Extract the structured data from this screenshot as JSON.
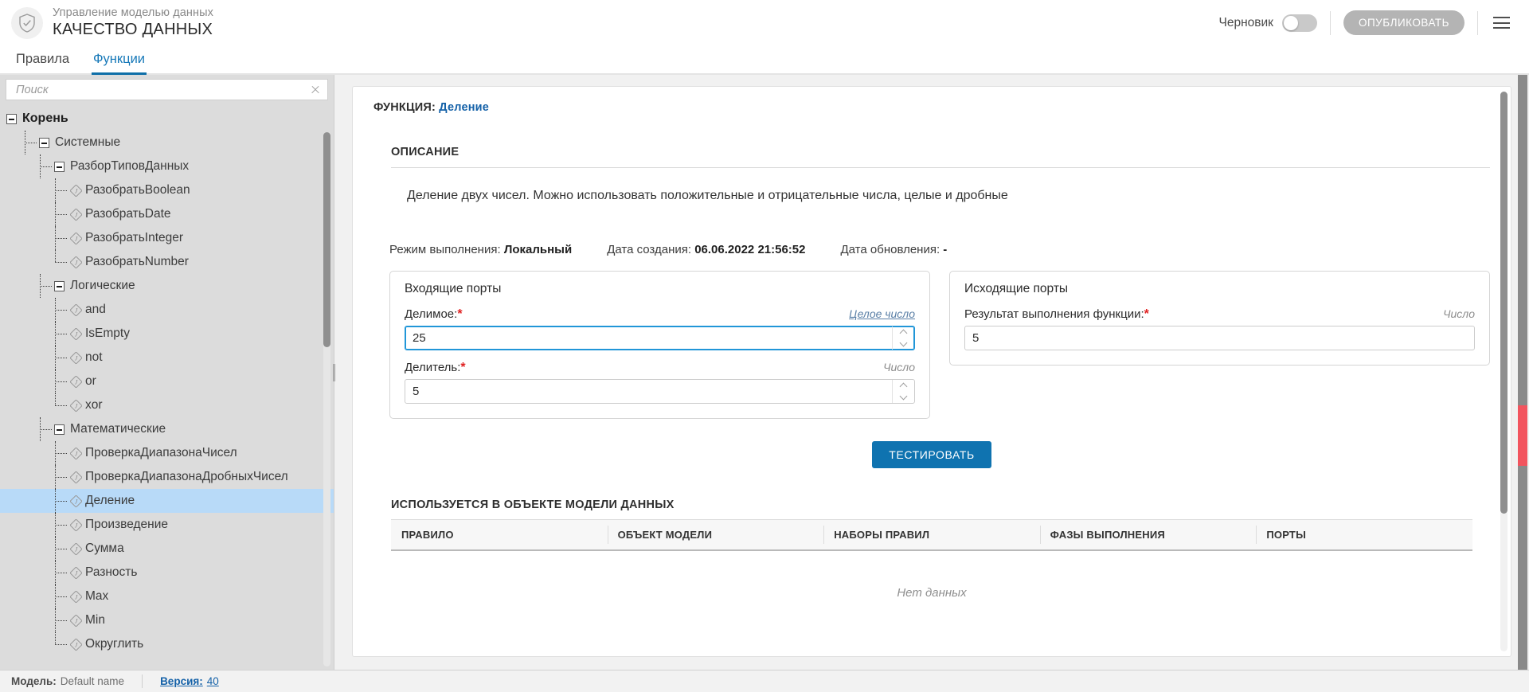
{
  "header": {
    "subtitle": "Управление моделью данных",
    "title": "КАЧЕСТВО ДАННЫХ",
    "shield_icon": "shield-check-icon",
    "draft_label": "Черновик",
    "draft_toggle_on": false,
    "publish_label": "ОПУБЛИКОВАТЬ",
    "menu_icon": "hamburger-menu-icon"
  },
  "tabs": [
    {
      "label": "Правила",
      "active": false
    },
    {
      "label": "Функции",
      "active": true
    }
  ],
  "sidebar": {
    "search_placeholder": "Поиск",
    "search_value": "",
    "clear_icon": "close-icon",
    "tree": [
      {
        "label": "Корень",
        "depth": 0,
        "type": "folder",
        "expanded": true,
        "selected": false,
        "last": false
      },
      {
        "label": "Системные",
        "depth": 1,
        "type": "folder",
        "expanded": true,
        "selected": false,
        "last": false
      },
      {
        "label": "РазборТиповДанных",
        "depth": 2,
        "type": "folder",
        "expanded": true,
        "selected": false,
        "last": false
      },
      {
        "label": "РазобратьBoolean",
        "depth": 3,
        "type": "function",
        "expanded": false,
        "selected": false,
        "last": false
      },
      {
        "label": "РазобратьDate",
        "depth": 3,
        "type": "function",
        "expanded": false,
        "selected": false,
        "last": false
      },
      {
        "label": "РазобратьInteger",
        "depth": 3,
        "type": "function",
        "expanded": false,
        "selected": false,
        "last": false
      },
      {
        "label": "РазобратьNumber",
        "depth": 3,
        "type": "function",
        "expanded": false,
        "selected": false,
        "last": true
      },
      {
        "label": "Логические",
        "depth": 2,
        "type": "folder",
        "expanded": true,
        "selected": false,
        "last": false
      },
      {
        "label": "and",
        "depth": 3,
        "type": "function",
        "expanded": false,
        "selected": false,
        "last": false
      },
      {
        "label": "IsEmpty",
        "depth": 3,
        "type": "function",
        "expanded": false,
        "selected": false,
        "last": false
      },
      {
        "label": "not",
        "depth": 3,
        "type": "function",
        "expanded": false,
        "selected": false,
        "last": false
      },
      {
        "label": "or",
        "depth": 3,
        "type": "function",
        "expanded": false,
        "selected": false,
        "last": false
      },
      {
        "label": "xor",
        "depth": 3,
        "type": "function",
        "expanded": false,
        "selected": false,
        "last": true
      },
      {
        "label": "Математические",
        "depth": 2,
        "type": "folder",
        "expanded": true,
        "selected": false,
        "last": false
      },
      {
        "label": "ПроверкаДиапазонаЧисел",
        "depth": 3,
        "type": "function",
        "expanded": false,
        "selected": false,
        "last": false
      },
      {
        "label": "ПроверкаДиапазонаДробныхЧисел",
        "depth": 3,
        "type": "function",
        "expanded": false,
        "selected": false,
        "last": false
      },
      {
        "label": "Деление",
        "depth": 3,
        "type": "function",
        "expanded": false,
        "selected": true,
        "last": false
      },
      {
        "label": "Произведение",
        "depth": 3,
        "type": "function",
        "expanded": false,
        "selected": false,
        "last": false
      },
      {
        "label": "Сумма",
        "depth": 3,
        "type": "function",
        "expanded": false,
        "selected": false,
        "last": false
      },
      {
        "label": "Разность",
        "depth": 3,
        "type": "function",
        "expanded": false,
        "selected": false,
        "last": false
      },
      {
        "label": "Max",
        "depth": 3,
        "type": "function",
        "expanded": false,
        "selected": false,
        "last": false
      },
      {
        "label": "Min",
        "depth": 3,
        "type": "function",
        "expanded": false,
        "selected": false,
        "last": false
      },
      {
        "label": "Округлить",
        "depth": 3,
        "type": "function",
        "expanded": false,
        "selected": false,
        "last": true
      }
    ]
  },
  "main": {
    "function_prefix": "ФУНКЦИЯ:",
    "function_name": "Деление",
    "description_title": "ОПИСАНИЕ",
    "description_text": "Деление двух чисел. Можно использовать положительные и отрицательные числа, целые и дробные",
    "meta": [
      {
        "label": "Режим выполнения:",
        "value": "Локальный"
      },
      {
        "label": "Дата создания:",
        "value": "06.06.2022 21:56:52"
      },
      {
        "label": "Дата обновления:",
        "value": "-"
      }
    ],
    "incoming": {
      "title": "Входящие порты",
      "fields": [
        {
          "label": "Делимое:",
          "required": true,
          "type": "Целое число",
          "type_is_link": true,
          "value": "25",
          "focused": true,
          "has_spinner": true
        },
        {
          "label": "Делитель:",
          "required": true,
          "type": "Число",
          "type_is_link": false,
          "value": "5",
          "focused": false,
          "has_spinner": true
        }
      ]
    },
    "outgoing": {
      "title": "Исходящие порты",
      "fields": [
        {
          "label": "Результат выполнения функции:",
          "required": true,
          "type": "Число",
          "type_is_link": false,
          "value": "5",
          "focused": false,
          "has_spinner": false
        }
      ]
    },
    "test_button": "ТЕСТИРОВАТЬ",
    "usage_title": "ИСПОЛЬЗУЕТСЯ В ОБЪЕКТЕ МОДЕЛИ ДАННЫХ",
    "usage_columns": [
      "ПРАВИЛО",
      "ОБЪЕКТ МОДЕЛИ",
      "НАБОРЫ ПРАВИЛ",
      "ФАЗЫ ВЫПОЛНЕНИЯ",
      "ПОРТЫ"
    ],
    "usage_rows": [],
    "no_data_text": "Нет данных"
  },
  "statusbar": {
    "model_label": "Модель:",
    "model_value": "Default name",
    "version_label": "Версия:",
    "version_value": "40"
  },
  "colors": {
    "accent": "#0f73b0",
    "link": "#1461a8",
    "required": "#e02020",
    "selection": "#b8daf8",
    "marker": "#f2545e",
    "publish_disabled": "#b4b4b4"
  }
}
